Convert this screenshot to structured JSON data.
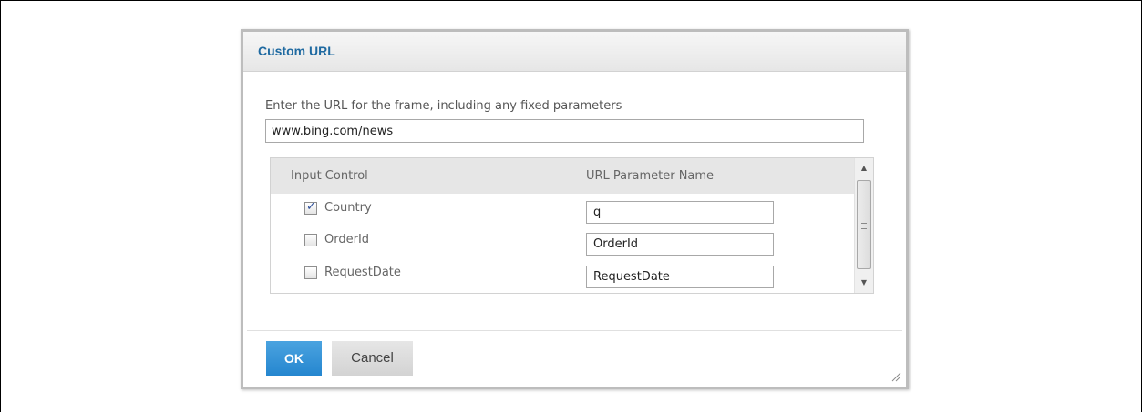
{
  "dialog": {
    "title": "Custom URL",
    "url_label": "Enter the URL for the frame, including any fixed parameters",
    "url_value": "www.bing.com/news"
  },
  "grid": {
    "columns": [
      "Input Control",
      "URL Parameter Name"
    ],
    "rows": [
      {
        "control": "Country",
        "checked": true,
        "param": "q"
      },
      {
        "control": "OrderId",
        "checked": false,
        "param": "OrderId"
      },
      {
        "control": "RequestDate",
        "checked": false,
        "param": "RequestDate"
      }
    ]
  },
  "buttons": {
    "ok": "OK",
    "cancel": "Cancel"
  },
  "icons": {
    "scroll_up": "triangle-up-icon",
    "scroll_down": "triangle-down-icon",
    "checkbox_checked": "checkmark-icon",
    "resize": "resize-grip-icon"
  },
  "colors": {
    "title": "#1f6aa1",
    "ok_button": "#2586cf",
    "header_bg": "#e6e6e6"
  }
}
